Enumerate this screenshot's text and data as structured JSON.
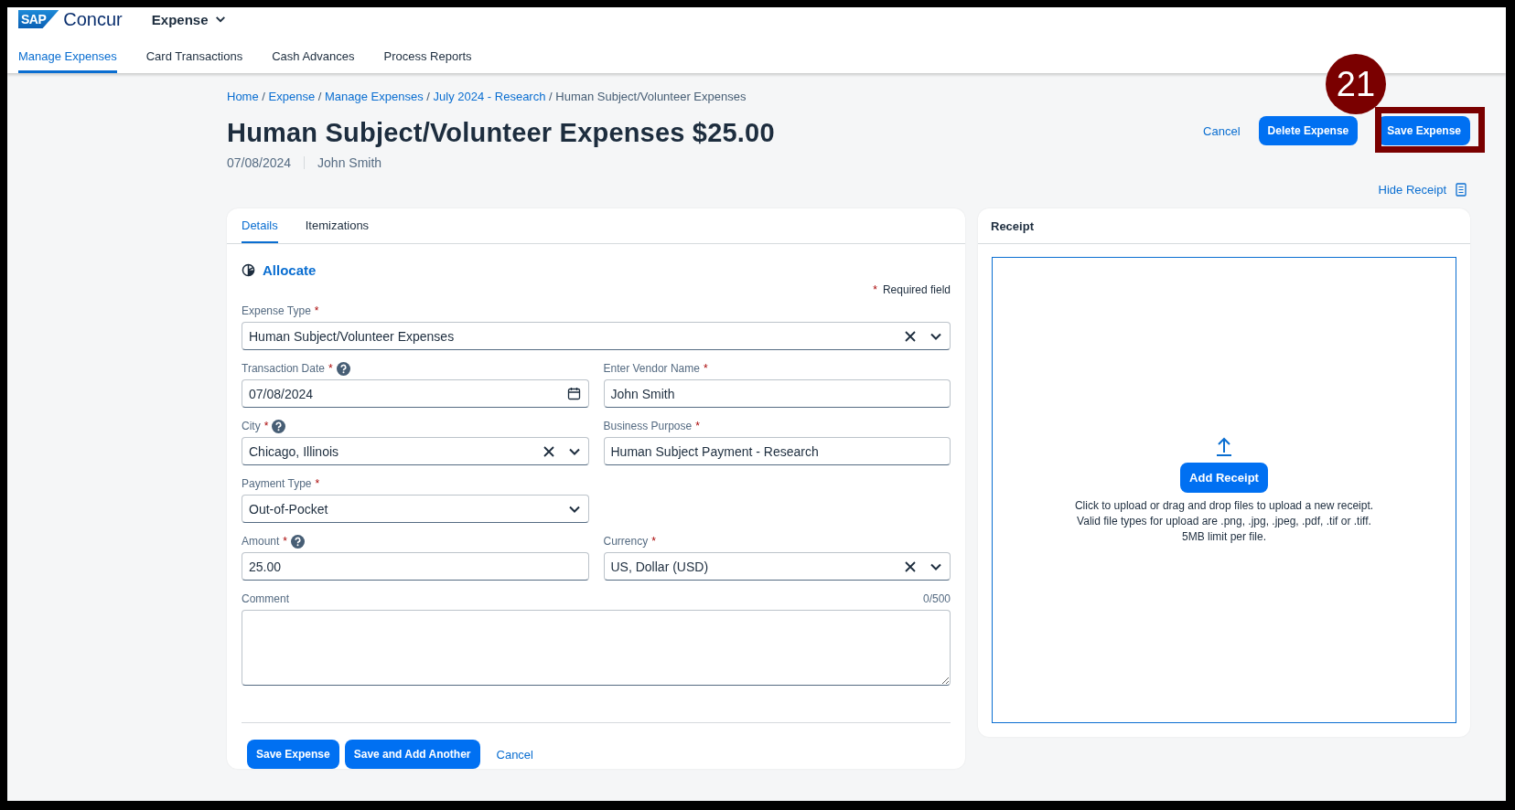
{
  "header": {
    "logo_mark": "SAP",
    "logo_text": "Concur",
    "app_menu": "Expense"
  },
  "nav_tabs": [
    {
      "label": "Manage Expenses",
      "selected": true
    },
    {
      "label": "Card Transactions",
      "selected": false
    },
    {
      "label": "Cash Advances",
      "selected": false
    },
    {
      "label": "Process Reports",
      "selected": false
    }
  ],
  "breadcrumb": {
    "separator": "/",
    "links": [
      "Home",
      "Expense",
      "Manage Expenses",
      "July 2024 - Research"
    ],
    "current": "Human Subject/Volunteer Expenses"
  },
  "title": "Human Subject/Volunteer Expenses $25.00",
  "subtitle": {
    "date": "07/08/2024",
    "owner": "John Smith"
  },
  "actions": {
    "cancel": "Cancel",
    "delete": "Delete Expense",
    "save": "Save Expense",
    "hide_receipt": "Hide Receipt"
  },
  "callout": {
    "number": "21"
  },
  "form_tabs": [
    {
      "label": "Details",
      "selected": true
    },
    {
      "label": "Itemizations",
      "selected": false
    }
  ],
  "allocate": "Allocate",
  "required_note": "Required field",
  "required_mark": "*",
  "fields": [
    [
      {
        "kind": "combo",
        "wide": true,
        "label": "Expense Type",
        "required": true,
        "help": false,
        "value": "Human Subject/Volunteer Expenses"
      }
    ],
    [
      {
        "kind": "date",
        "wide": false,
        "label": "Transaction Date",
        "required": true,
        "help": true,
        "value": "07/08/2024"
      },
      {
        "kind": "text",
        "wide": false,
        "label": "Enter Vendor Name",
        "required": true,
        "help": false,
        "value": "John Smith"
      }
    ],
    [
      {
        "kind": "combo",
        "wide": false,
        "label": "City",
        "required": true,
        "help": true,
        "value": "Chicago, Illinois"
      },
      {
        "kind": "text",
        "wide": false,
        "label": "Business Purpose",
        "required": true,
        "help": false,
        "value": "Human Subject Payment - Research"
      }
    ],
    [
      {
        "kind": "select",
        "wide": false,
        "label": "Payment Type",
        "required": true,
        "help": false,
        "value": "Out-of-Pocket"
      }
    ],
    [
      {
        "kind": "text",
        "wide": false,
        "label": "Amount",
        "required": true,
        "help": true,
        "value": "25.00"
      },
      {
        "kind": "combo",
        "wide": false,
        "label": "Currency",
        "required": true,
        "help": false,
        "value": "US, Dollar (USD)"
      }
    ],
    [
      {
        "kind": "textarea",
        "wide": true,
        "label": "Comment",
        "required": false,
        "help": false,
        "counter": "0/500"
      }
    ]
  ],
  "form_buttons": {
    "save": "Save Expense",
    "save_another": "Save and Add Another",
    "cancel": "Cancel"
  },
  "receipt": {
    "title": "Receipt",
    "add_button": "Add Receipt",
    "hint_lines": [
      "Click to upload or drag and drop files to upload a new receipt.",
      "Valid file types for upload are .png, .jpg, .jpeg, .pdf, .tif or .tiff.",
      "5MB limit per file."
    ]
  }
}
